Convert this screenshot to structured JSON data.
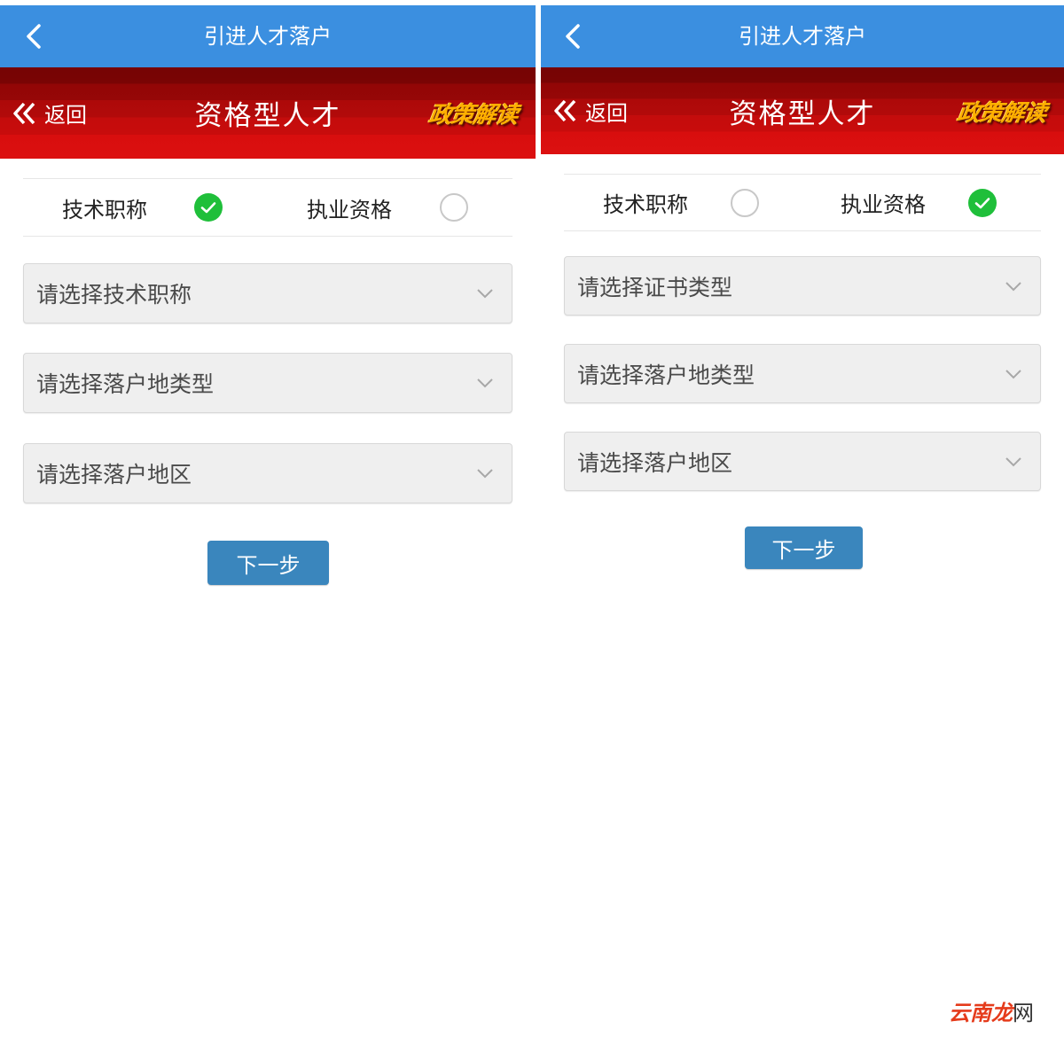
{
  "watermark": {
    "part1": "云南",
    "part2": "龙",
    "part3": "网"
  },
  "screens": [
    {
      "appbar": {
        "title": "引进人才落户"
      },
      "banner": {
        "back_label": "返回",
        "title": "资格型人才",
        "policy_label": "政策解读"
      },
      "radio": {
        "options": [
          {
            "label": "技术职称",
            "checked": true
          },
          {
            "label": "执业资格",
            "checked": false
          }
        ]
      },
      "selects": [
        {
          "placeholder": "请选择技术职称"
        },
        {
          "placeholder": "请选择落户地类型"
        },
        {
          "placeholder": "请选择落户地区"
        }
      ],
      "next_label": "下一步"
    },
    {
      "appbar": {
        "title": "引进人才落户"
      },
      "banner": {
        "back_label": "返回",
        "title": "资格型人才",
        "policy_label": "政策解读"
      },
      "radio": {
        "options": [
          {
            "label": "技术职称",
            "checked": false
          },
          {
            "label": "执业资格",
            "checked": true
          }
        ]
      },
      "selects": [
        {
          "placeholder": "请选择证书类型"
        },
        {
          "placeholder": "请选择落户地类型"
        },
        {
          "placeholder": "请选择落户地区"
        }
      ],
      "next_label": "下一步"
    }
  ],
  "colors": {
    "appbar": "#3b8fe0",
    "banner_red": "#d80e0e",
    "check_green": "#1fbf3a",
    "button_blue": "#3a86bd",
    "policy_gold": "#ffb000"
  },
  "icons": {
    "appbar_back": "chevron-left-icon",
    "banner_back": "double-chevron-left-icon",
    "checked": "check-circle-icon",
    "unchecked": "empty-circle-icon",
    "select": "chevron-down-icon"
  }
}
